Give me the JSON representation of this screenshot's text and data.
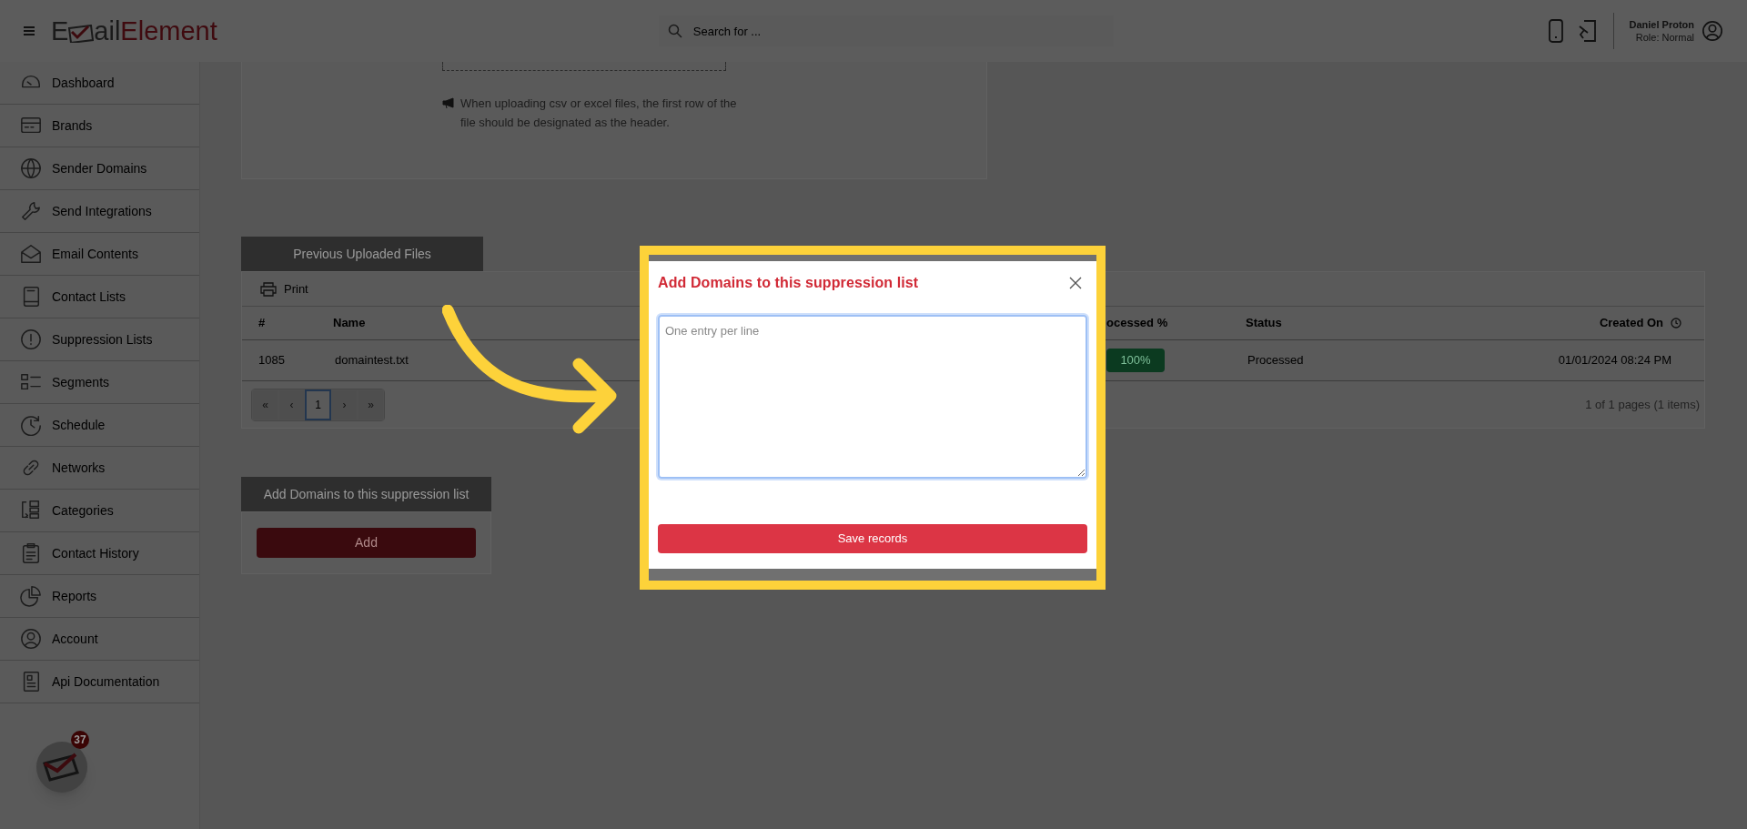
{
  "header": {
    "logo": {
      "first": "E",
      "rest": "ail",
      "accent": "Element"
    },
    "search": {
      "placeholder": "Search for ..."
    },
    "user": {
      "name": "Daniel Proton",
      "role": "Role: Normal"
    }
  },
  "sidebar": {
    "items": [
      {
        "label": "Dashboard"
      },
      {
        "label": "Brands"
      },
      {
        "label": "Sender Domains"
      },
      {
        "label": "Send Integrations"
      },
      {
        "label": "Email Contents"
      },
      {
        "label": "Contact Lists"
      },
      {
        "label": "Suppression Lists"
      },
      {
        "label": "Segments"
      },
      {
        "label": "Schedule"
      },
      {
        "label": "Networks"
      },
      {
        "label": "Categories"
      },
      {
        "label": "Contact History"
      },
      {
        "label": "Reports"
      },
      {
        "label": "Account"
      },
      {
        "label": "Api Documentation"
      }
    ]
  },
  "upload_note": "When uploading csv or excel files, the first row of the file should be designated as the header.",
  "previous_files": {
    "tab": "Previous Uploaded Files",
    "print": "Print",
    "columns": [
      "#",
      "Name",
      "ocessed %",
      "Status",
      "Created On"
    ],
    "rows": [
      {
        "id": "1085",
        "name": "domaintest.txt",
        "processed": "100%",
        "status": "Processed",
        "created": "01/01/2024 08:24 PM"
      }
    ],
    "pagination": [
      {
        "label": "«",
        "selected": false
      },
      {
        "label": "‹",
        "selected": false
      },
      {
        "label": "1",
        "selected": true
      },
      {
        "label": "›",
        "selected": false
      },
      {
        "label": "»",
        "selected": false
      }
    ],
    "summary": "1 of 1 pages (1 items)"
  },
  "add_domains": {
    "tab": "Add Domains to this suppression list",
    "button": "Add"
  },
  "notification_badge": "37",
  "modal": {
    "title": "Add Domains to this suppression list",
    "textarea": {
      "placeholder": "One entry per line"
    },
    "button": "Save records"
  }
}
